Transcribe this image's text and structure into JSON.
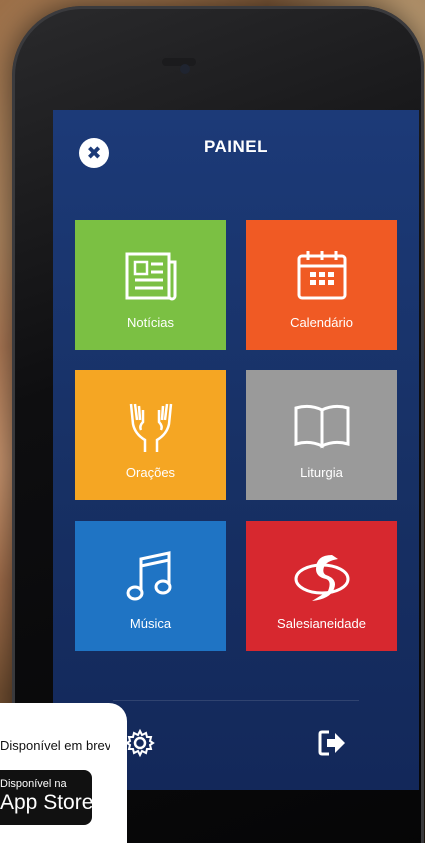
{
  "app": {
    "title": "PAINEL"
  },
  "header": {
    "close_icon": "close-icon"
  },
  "tiles": [
    {
      "label": "Notícias",
      "icon": "newspaper-icon",
      "color": "#7bc043"
    },
    {
      "label": "Calendário",
      "icon": "calendar-icon",
      "color": "#f05a24"
    },
    {
      "label": "Orações",
      "icon": "praying-hands-icon",
      "color": "#f5a623"
    },
    {
      "label": "Liturgia",
      "icon": "open-book-icon",
      "color": "#9a9a9a"
    },
    {
      "label": "Música",
      "icon": "music-note-icon",
      "color": "#1f74c4"
    },
    {
      "label": "Salesianeidade",
      "icon": "salesian-logo-icon",
      "color": "#d7282f"
    }
  ],
  "footer": {
    "settings_icon": "gear-icon",
    "exit_icon": "exit-icon"
  },
  "store_panel": {
    "text": "Disponível em breve:",
    "badge_small": "Disponível na",
    "badge_big": "App Store"
  },
  "colors": {
    "screen_bg": "#1c3a78",
    "accent_white": "#ffffff"
  }
}
